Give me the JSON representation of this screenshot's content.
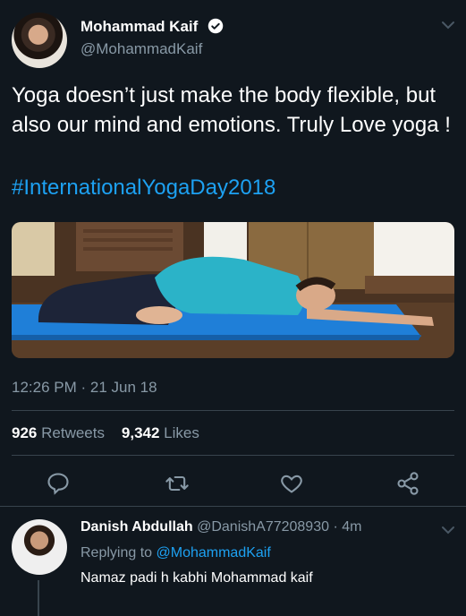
{
  "tweet": {
    "author_name": "Mohammad Kaif",
    "author_handle": "@MohammadKaif",
    "text": "Yoga doesn’t just make the body flexible, but also our mind and emotions. Truly Love yoga !",
    "hashtag": "#InternationalYogaDay2018",
    "timestamp": "12:26 PM · 21 Jun 18",
    "retweets_count": "926",
    "retweets_label": "Retweets",
    "likes_count": "9,342",
    "likes_label": "Likes",
    "media_alt": "photo",
    "icons": {
      "more": "chevron-down-icon",
      "verified": "verified-icon",
      "reply": "reply-icon",
      "retweet": "retweet-icon",
      "like": "heart-icon",
      "share": "share-icon"
    },
    "colors": {
      "background": "#10171e",
      "accent": "#1da1f2",
      "muted": "#8899a6",
      "divider": "#38444d"
    }
  },
  "reply": {
    "author_name": "Danish Abdullah",
    "author_handle": "@DanishA77208930",
    "time": "· 4m",
    "replying_prefix": "Replying to",
    "replying_to": "@MohammadKaif",
    "text": "Namaz padi h kabhi Mohammad kaif"
  }
}
